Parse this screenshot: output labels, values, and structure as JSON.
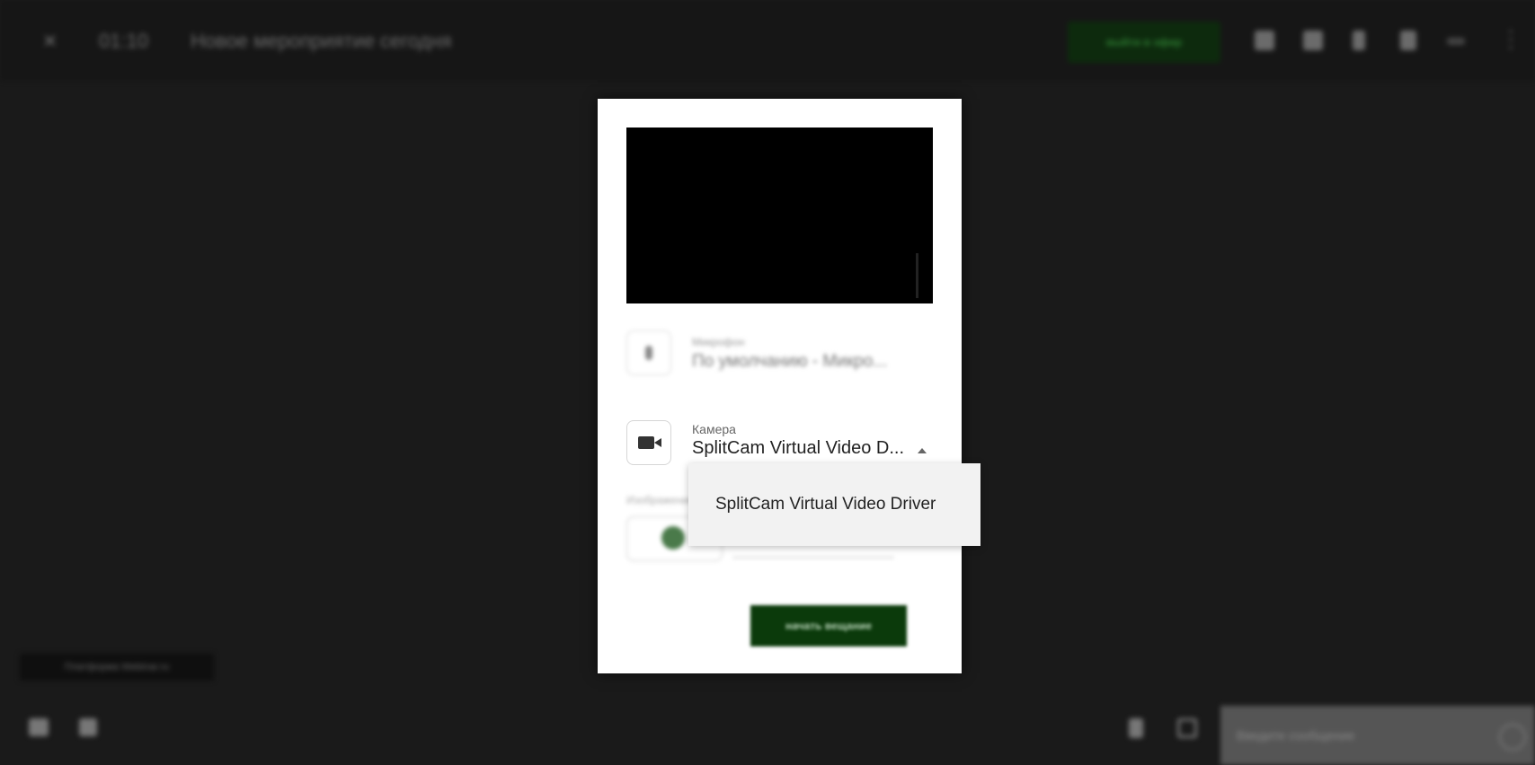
{
  "header": {
    "close_glyph": "×",
    "timer": "01:10",
    "title": "Новое мероприятие сегодня",
    "stage_button": "выйти в эфир",
    "more_glyph": "⋮",
    "icons": [
      "chat-icon",
      "messages-icon",
      "participants-icon",
      "document-icon",
      "subtitles-icon"
    ]
  },
  "footer": {
    "platform_label": "Платформа Webinar.ru",
    "message_placeholder": "Введите сообщение",
    "left_icons": [
      "monitor-icon",
      "pointer-icon"
    ],
    "right_icons": [
      "text-icon",
      "image-icon"
    ]
  },
  "modal": {
    "microphone": {
      "label": "Микрофон",
      "value": "По умолчанию - Микро..."
    },
    "camera": {
      "label": "Камера",
      "value": "SplitCam Virtual Video D..."
    },
    "extra_label": "Изображение",
    "start_button": "начать вещание"
  },
  "dropdown": {
    "options": [
      "SplitCam Virtual Video Driver"
    ]
  },
  "colors": {
    "background": "#1a1a1a",
    "accent_green": "#0b3a0b",
    "modal_bg": "#ffffff",
    "dropdown_bg": "#f2f2f2"
  }
}
